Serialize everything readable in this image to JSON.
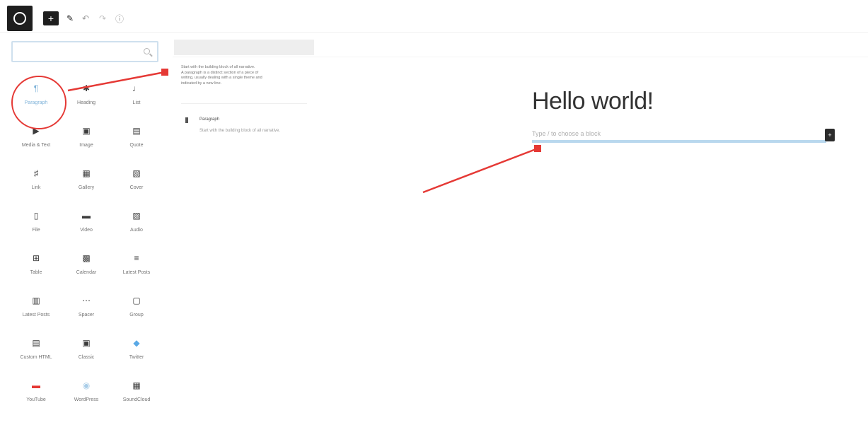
{
  "toolbar": {
    "logo_icon": "wordpress-icon",
    "add_block_icon": "plus-icon",
    "add_block_glyph": "+",
    "tools_icon": "pencil-icon",
    "tools_glyph": "✎",
    "undo_icon": "undo-icon",
    "undo_glyph": "↶",
    "redo_icon": "redo-icon",
    "redo_glyph": "↷",
    "info_icon": "info-icon",
    "info_glyph": "ⓘ"
  },
  "inserter": {
    "search_value": "",
    "search_placeholder": "",
    "blocks": [
      {
        "label": "Paragraph",
        "icon": "paragraph-icon",
        "glyph": "¶",
        "active": true
      },
      {
        "label": "Heading",
        "icon": "heading-icon",
        "glyph": "✱"
      },
      {
        "label": "List",
        "icon": "list-icon",
        "glyph": "♩"
      },
      {
        "label": "Media & Text",
        "icon": "media-text-icon",
        "glyph": "▶"
      },
      {
        "label": "Image",
        "icon": "image-icon",
        "glyph": "▣"
      },
      {
        "label": "Quote",
        "icon": "quote-icon",
        "glyph": "▤"
      },
      {
        "label": "Link",
        "icon": "link-icon",
        "glyph": "♯"
      },
      {
        "label": "Gallery",
        "icon": "gallery-icon",
        "glyph": "▦"
      },
      {
        "label": "Cover",
        "icon": "cover-icon",
        "glyph": "▧"
      },
      {
        "label": "File",
        "icon": "file-icon",
        "glyph": "▯"
      },
      {
        "label": "Video",
        "icon": "video-icon",
        "glyph": "▬"
      },
      {
        "label": "Audio",
        "icon": "audio-icon",
        "glyph": "▨"
      },
      {
        "label": "Table",
        "icon": "table-icon",
        "glyph": "⊞"
      },
      {
        "label": "Calendar",
        "icon": "calendar-icon",
        "glyph": "▩"
      },
      {
        "label": "Latest Posts",
        "icon": "latest-posts-icon",
        "glyph": "≡"
      },
      {
        "label": "Latest Posts",
        "icon": "columns-icon",
        "glyph": "▥"
      },
      {
        "label": "Spacer",
        "icon": "separator-icon",
        "glyph": "⋯"
      },
      {
        "label": "Group",
        "icon": "group-icon",
        "glyph": "▢"
      },
      {
        "label": "Custom HTML",
        "icon": "html-icon",
        "glyph": "▤"
      },
      {
        "label": "Classic",
        "icon": "classic-icon",
        "glyph": "▣"
      },
      {
        "label": "Twitter",
        "icon": "twitter-icon",
        "glyph": "◆"
      },
      {
        "label": "YouTube",
        "icon": "youtube-icon",
        "glyph": "▬"
      },
      {
        "label": "WordPress",
        "icon": "wordpress-embed-icon",
        "glyph": "◉"
      },
      {
        "label": "SoundCloud",
        "icon": "soundcloud-icon",
        "glyph": "▦"
      }
    ]
  },
  "preview": {
    "description_lines": [
      "Start with the building block of all narrative.",
      "A paragraph is a distinct section of a piece of",
      "writing, usually dealing with a single theme and",
      "indicated by a new line."
    ],
    "card_title": "Paragraph",
    "card_subtitle": "Start with the building block of all narrative.",
    "card_icon": "paragraph-icon"
  },
  "editor": {
    "post_title": "Hello world!",
    "paragraph_placeholder": "Type / to choose a block",
    "block_toggle_icon": "plus-icon",
    "block_toggle_glyph": "+"
  },
  "colors": {
    "annotation_red": "#e53935",
    "accent_blue": "#b9d8ee"
  }
}
